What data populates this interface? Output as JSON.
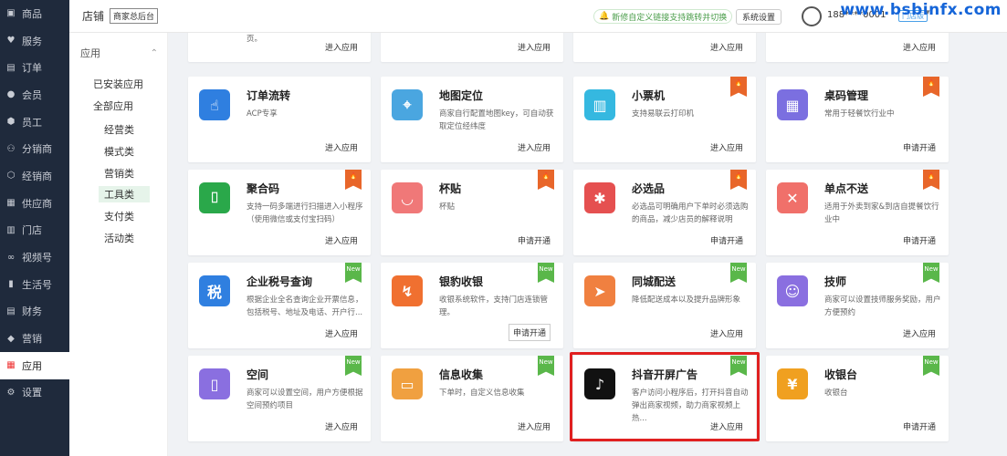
{
  "left_nav": [
    {
      "label": "商品",
      "icon": "box-icon"
    },
    {
      "label": "服务",
      "icon": "heart-icon"
    },
    {
      "label": "订单",
      "icon": "order-icon"
    },
    {
      "label": "会员",
      "icon": "user-icon"
    },
    {
      "label": "员工",
      "icon": "staff-icon"
    },
    {
      "label": "分销商",
      "icon": "distributor-icon"
    },
    {
      "label": "经销商",
      "icon": "dealer-icon"
    },
    {
      "label": "供应商",
      "icon": "supplier-icon"
    },
    {
      "label": "门店",
      "icon": "store-icon"
    },
    {
      "label": "视频号",
      "icon": "video-icon"
    },
    {
      "label": "生活号",
      "icon": "life-icon"
    },
    {
      "label": "财务",
      "icon": "finance-icon"
    },
    {
      "label": "营销",
      "icon": "marketing-icon"
    },
    {
      "label": "应用",
      "icon": "apps-icon"
    },
    {
      "label": "设置",
      "icon": "settings-icon"
    }
  ],
  "left_nav_active": "应用",
  "topbar": {
    "title": "店铺",
    "tag": "商家总后台",
    "notice": "新修自定义链接支持跳转并切换",
    "settings": "系统设置",
    "phone": "188****0001",
    "store_type": "门店版"
  },
  "watermark": "www.bsbinfx.com",
  "sub_nav": {
    "header": "应用",
    "items": [
      "已安装应用",
      "全部应用"
    ],
    "children": [
      "经营类",
      "模式类",
      "营销类",
      "工具类",
      "支付类",
      "活动类"
    ],
    "active": "工具类"
  },
  "top_actions": [
    "进入应用",
    "进入应用",
    "进入应用",
    "进入应用"
  ],
  "top_desc_tail": "页。",
  "cards": [
    {
      "name": "订单流转",
      "desc": "ACP专享",
      "action": "进入应用",
      "badge": "",
      "icon": "hand-pointer-icon",
      "color": "#2f7fe0"
    },
    {
      "name": "地图定位",
      "desc": "商家自行配置地图key，可自动获取定位经纬度",
      "action": "进入应用",
      "badge": "",
      "icon": "map-pin-icon",
      "color": "#4aa6e0"
    },
    {
      "name": "小票机",
      "desc": "支持易联云打印机",
      "action": "进入应用",
      "badge": "hot",
      "icon": "receipt-printer-icon",
      "color": "#35b8e0"
    },
    {
      "name": "桌码管理",
      "desc": "常用于轻餐饮行业中",
      "action": "申请开通",
      "badge": "hot",
      "icon": "qr-grid-icon",
      "color": "#7b6fe0"
    },
    {
      "name": "聚合码",
      "desc": "支持一码多端进行扫描进入小程序（使用微信或支付宝扫码）",
      "action": "进入应用",
      "badge": "hot",
      "icon": "scan-code-icon",
      "color": "#2aa84a"
    },
    {
      "name": "杯贴",
      "desc": "杯贴",
      "action": "申请开通",
      "badge": "hot",
      "icon": "cup-icon",
      "color": "#f07878"
    },
    {
      "name": "必选品",
      "desc": "必选品可明确用户下单时必须选购的商品，减少店员的解释说明",
      "action": "申请开通",
      "badge": "hot",
      "icon": "asterisk-icon",
      "color": "#e55050"
    },
    {
      "name": "单点不送",
      "desc": "适用于外卖到家&到店自提餐饮行业中",
      "action": "申请开通",
      "badge": "hot",
      "icon": "no-delivery-icon",
      "color": "#f0706a"
    },
    {
      "name": "企业税号查询",
      "desc": "根据企业全名查询企业开票信息，包括税号、地址及电话、开户行...",
      "action": "进入应用",
      "badge": "new",
      "icon": "tax-icon",
      "color": "#2f7fe0"
    },
    {
      "name": "银豹收银",
      "desc": "收银系统软件，支持门店连锁管理。",
      "action": "申请开通",
      "badge": "new",
      "icon": "leopard-icon",
      "color": "#f07030"
    },
    {
      "name": "同城配送",
      "desc": "降低配送成本以及提升品牌形象",
      "action": "进入应用",
      "badge": "new",
      "icon": "runner-icon",
      "color": "#f08040"
    },
    {
      "name": "技师",
      "desc": "商家可以设置技师服务奖励，用户方便预约",
      "action": "进入应用",
      "badge": "new",
      "icon": "technician-icon",
      "color": "#8a6fe0"
    },
    {
      "name": "空间",
      "desc": "商家可以设置空间，用户方便根据空间预约项目",
      "action": "进入应用",
      "badge": "new",
      "icon": "door-icon",
      "color": "#8a6fe0"
    },
    {
      "name": "信息收集",
      "desc": "下单时，自定义信息收集",
      "action": "进入应用",
      "badge": "new",
      "icon": "inbox-icon",
      "color": "#f0a040"
    },
    {
      "name": "抖音开屏广告",
      "desc": "客户访问小程序后，打开抖音自动弹出商家视频，助力商家视频上热...",
      "action": "进入应用",
      "badge": "new",
      "icon": "tiktok-icon",
      "color": "#111111"
    },
    {
      "name": "收银台",
      "desc": "收银台",
      "action": "申请开通",
      "badge": "new",
      "icon": "cashier-icon",
      "color": "#f0a020"
    }
  ],
  "highlight_card": "抖音开屏广告",
  "badge_text": {
    "new": "New",
    "hot": "HOT"
  },
  "colors": {
    "nav_bg": "#1f2a3c",
    "hot": "#e8662a",
    "new": "#5ab74a",
    "highlight": "#e02020"
  }
}
